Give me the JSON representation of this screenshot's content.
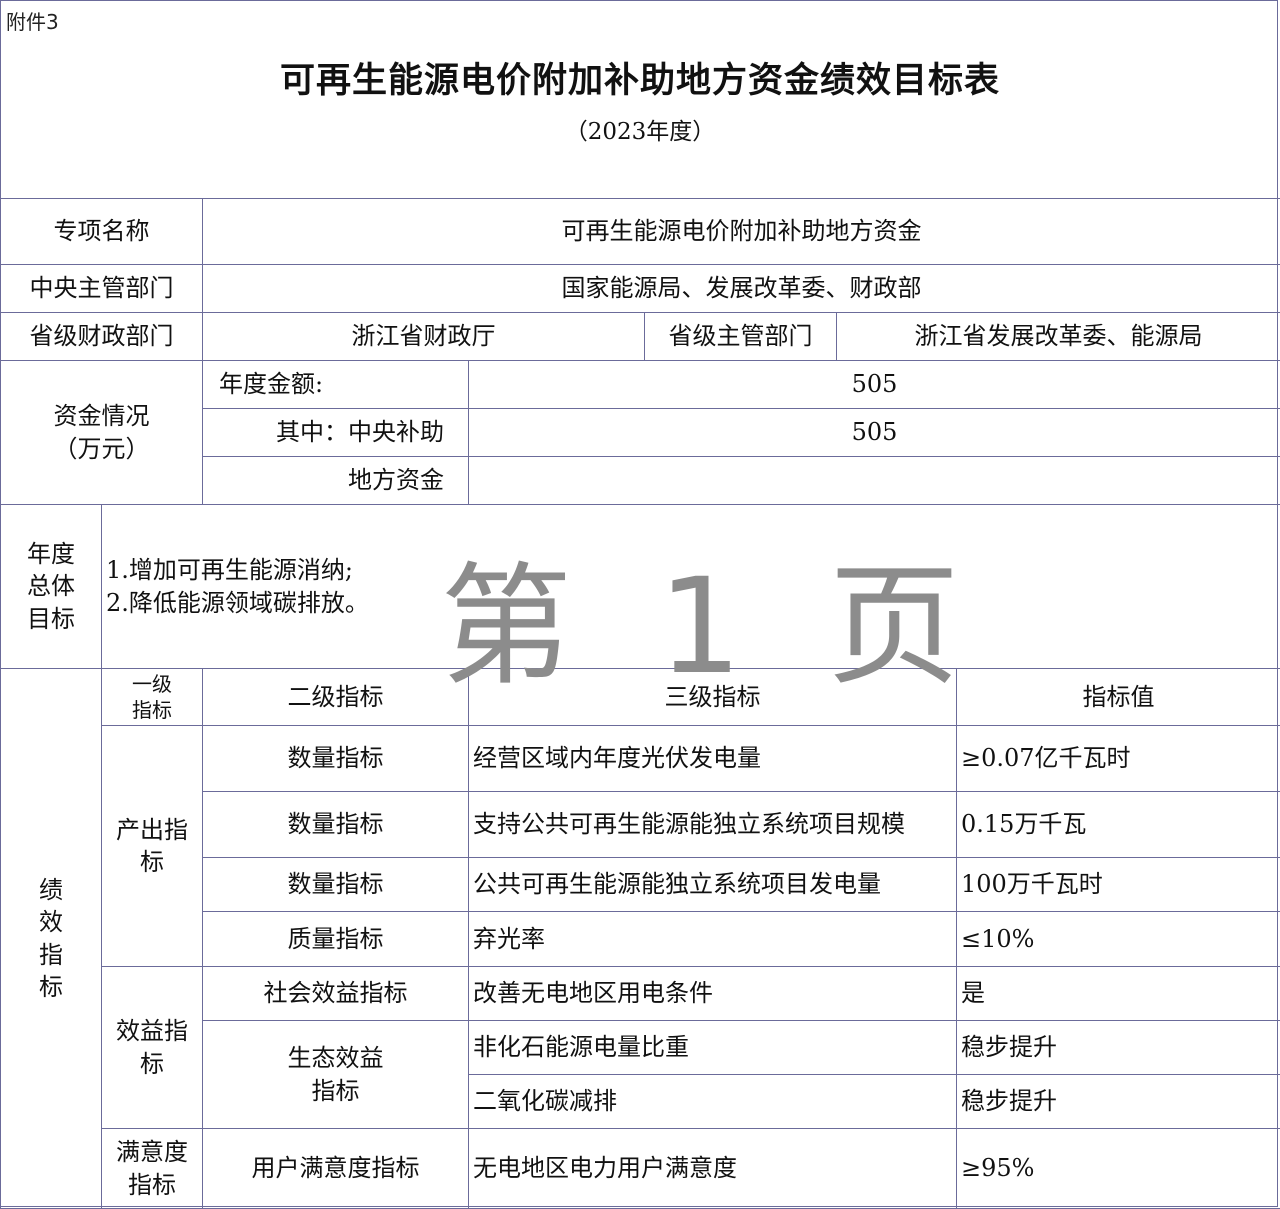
{
  "attachment_label": "附件3",
  "title": "可再生能源电价附加补助地方资金绩效目标表",
  "subtitle": "（2023年度）",
  "info": {
    "project_name_label": "专项名称",
    "project_name": "可再生能源电价附加补助地方资金",
    "central_dept_label": "中央主管部门",
    "central_dept": "国家能源局、发展改革委、财政部",
    "prov_finance_label": "省级财政部门",
    "prov_finance": "浙江省财政厅",
    "prov_dept_label": "省级主管部门",
    "prov_dept": "浙江省发展改革委、能源局"
  },
  "funds": {
    "label_line1": "资金情况",
    "label_line2": "（万元）",
    "annual_label": "年度金额:",
    "annual_value": "505",
    "central_label": "其中：中央补助",
    "central_value": "505",
    "local_label": "地方资金",
    "local_value": ""
  },
  "goals": {
    "label_line1": "年度",
    "label_line2": "总体",
    "label_line3": "目标",
    "item1": "1.增加可再生能源消纳;",
    "item2": "2.降低能源领域碳排放。"
  },
  "watermark": "第 1 页",
  "indicators": {
    "section_label": [
      "绩",
      "效",
      "指",
      "标"
    ],
    "headers": {
      "level1_line1": "一级",
      "level1_line2": "指标",
      "level2": "二级指标",
      "level3": "三级指标",
      "value": "指标值"
    },
    "groups": {
      "output_line1": "产出指",
      "output_line2": "标",
      "benefit_line1": "效益指",
      "benefit_line2": "标",
      "satisfaction_line1": "满意度",
      "satisfaction_line2": "指标",
      "eco_line1": "生态效益",
      "eco_line2": "指标"
    },
    "rows": [
      {
        "level2": "数量指标",
        "level3": "经营区域内年度光伏发电量",
        "value": "≥0.07亿千瓦时"
      },
      {
        "level2": "数量指标",
        "level3": "支持公共可再生能源能独立系统项目规模",
        "value": "0.15万千瓦"
      },
      {
        "level2": "数量指标",
        "level3": "公共可再生能源能独立系统项目发电量",
        "value": "100万千瓦时"
      },
      {
        "level2": "质量指标",
        "level3": "弃光率",
        "value": "≤10%"
      },
      {
        "level2": "社会效益指标",
        "level3": "改善无电地区用电条件",
        "value": "是"
      },
      {
        "level2": "",
        "level3": "非化石能源电量比重",
        "value": "稳步提升"
      },
      {
        "level2": "",
        "level3": "二氧化碳减排",
        "value": "稳步提升"
      },
      {
        "level2": "用户满意度指标",
        "level3": "无电地区电力用户满意度",
        "value": "≥95%"
      }
    ]
  }
}
